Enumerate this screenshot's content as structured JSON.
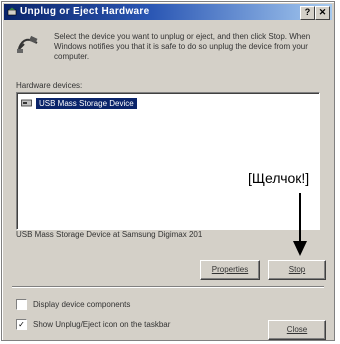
{
  "window": {
    "title": "Unplug or Eject Hardware",
    "help_btn": "?",
    "close_btn": "✕"
  },
  "description": "Select the device you want to unplug or eject, and then click Stop. When Windows notifies you that it is safe to do so unplug the device from your computer.",
  "hardware_label": "Hardware devices:",
  "devices": [
    {
      "name": "USB Mass Storage Device",
      "selected": true
    }
  ],
  "status_text": "USB Mass Storage Device at Samsung Digimax 201",
  "buttons": {
    "properties": "Properties",
    "stop": "Stop",
    "close": "Close"
  },
  "checkboxes": [
    {
      "label": "Display device components",
      "checked": false
    },
    {
      "label": "Show Unplug/Eject icon on the taskbar",
      "checked": true
    }
  ],
  "annotation": "[Щелчок!]",
  "colors": {
    "titlebar_start": "#0a246a",
    "titlebar_end": "#a6caf0",
    "face": "#d4d0c8",
    "selection": "#0a246a"
  }
}
